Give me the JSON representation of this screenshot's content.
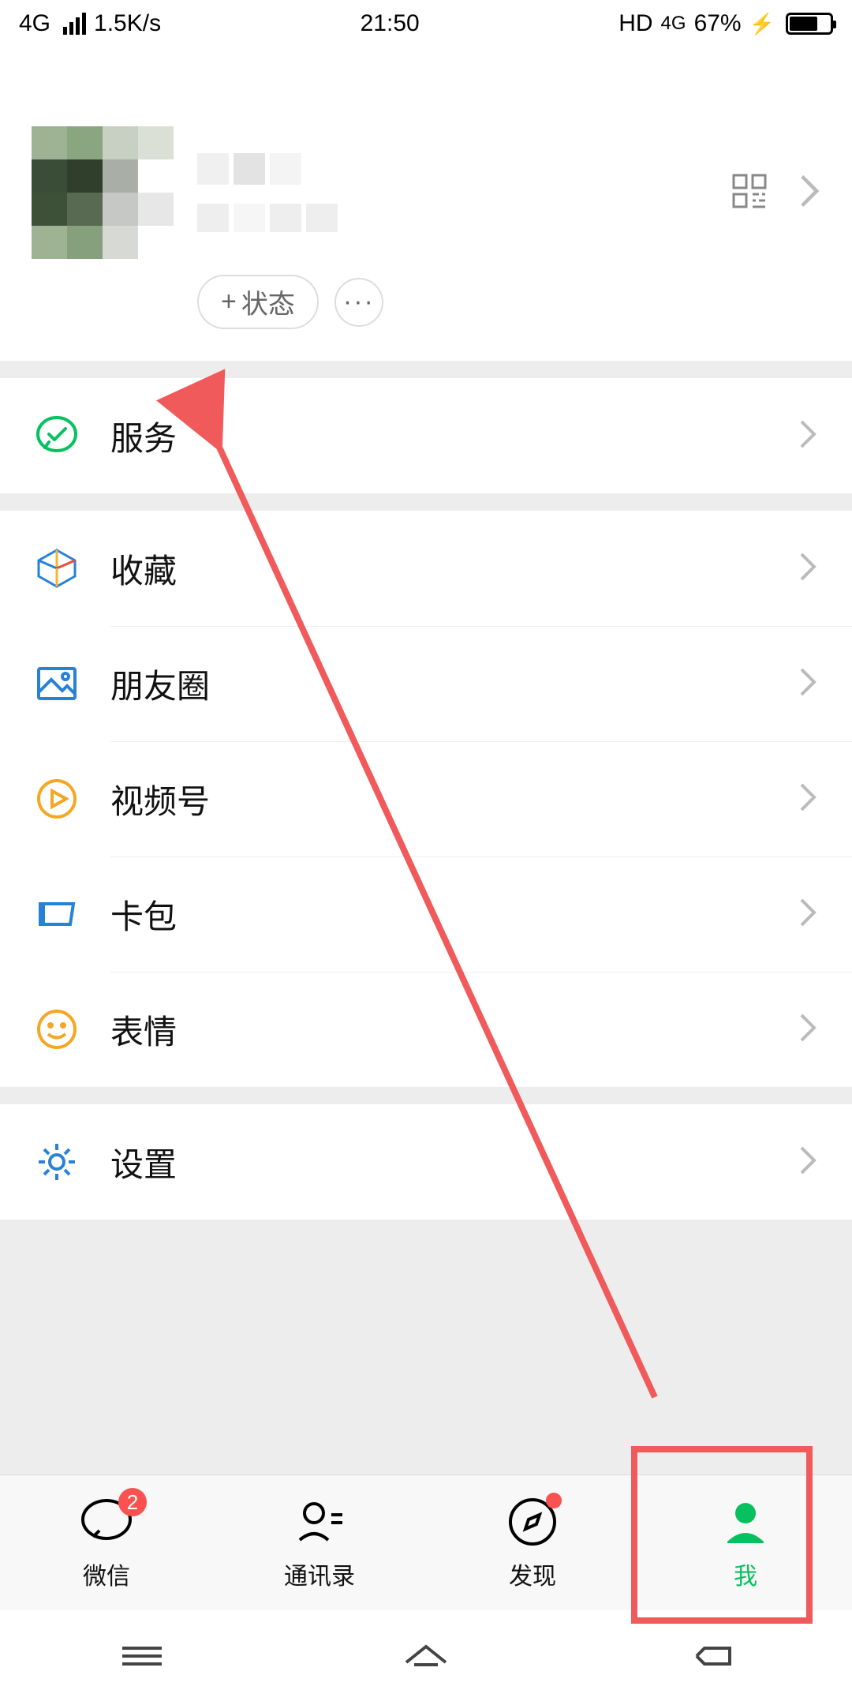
{
  "status": {
    "net": "4G",
    "speed": "1.5K/s",
    "time": "21:50",
    "hd": "HD",
    "net2": "4G",
    "battery": "67%"
  },
  "profile": {
    "status_btn": "状态",
    "more_btn": "···"
  },
  "menu": {
    "services": "服务",
    "favorites": "收藏",
    "moments": "朋友圈",
    "channels": "视频号",
    "cards": "卡包",
    "stickers": "表情",
    "settings": "设置"
  },
  "tabs": {
    "chat": "微信",
    "chat_badge": "2",
    "contacts": "通讯录",
    "discover": "发现",
    "me": "我"
  },
  "colors": {
    "accent": "#07c160",
    "badge": "#fa5151",
    "annotation": "#f05a5a"
  }
}
